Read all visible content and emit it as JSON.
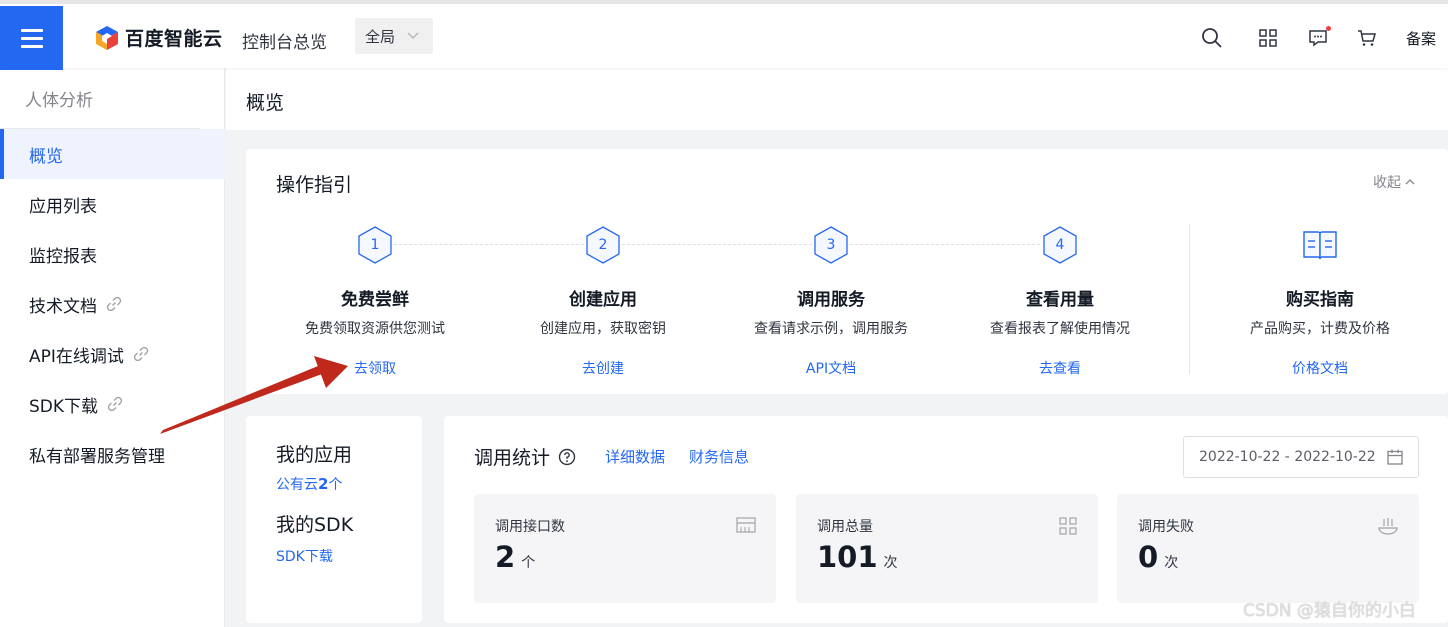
{
  "header": {
    "brand": "百度智能云",
    "console_title": "控制台总览",
    "region": "全局",
    "beian": "备案",
    "icons": [
      "menu-icon",
      "search-icon",
      "apps-grid-icon",
      "message-icon",
      "cart-icon"
    ]
  },
  "sidebar": {
    "title": "人体分析",
    "items": [
      {
        "label": "概览",
        "active": true,
        "external": false
      },
      {
        "label": "应用列表",
        "active": false,
        "external": false
      },
      {
        "label": "监控报表",
        "active": false,
        "external": false
      },
      {
        "label": "技术文档",
        "active": false,
        "external": true
      },
      {
        "label": "API在线调试",
        "active": false,
        "external": true
      },
      {
        "label": "SDK下载",
        "active": false,
        "external": true
      },
      {
        "label": "私有部署服务管理",
        "active": false,
        "external": false
      }
    ]
  },
  "page": {
    "title": "概览"
  },
  "guide": {
    "title": "操作指引",
    "collapse_label": "收起",
    "steps": [
      {
        "number": "1",
        "name": "免费尝鲜",
        "desc": "免费领取资源供您测试",
        "link": "去领取"
      },
      {
        "number": "2",
        "name": "创建应用",
        "desc": "创建应用，获取密钥",
        "link": "去创建"
      },
      {
        "number": "3",
        "name": "调用服务",
        "desc": "查看请求示例，调用服务",
        "link": "API文档"
      },
      {
        "number": "4",
        "name": "查看用量",
        "desc": "查看报表了解使用情况",
        "link": "去查看"
      }
    ],
    "purchase": {
      "name": "购买指南",
      "desc": "产品购买，计费及价格",
      "link": "价格文档"
    }
  },
  "my_apps": {
    "title": "我的应用",
    "public_cloud_prefix": "公有云",
    "public_cloud_count": "2",
    "public_cloud_unit": "个",
    "sdk_title": "我的SDK",
    "sdk_link": "SDK下载"
  },
  "stats": {
    "title": "调用统计",
    "tabs": [
      "详细数据",
      "财务信息"
    ],
    "date_range": "2022-10-22 - 2022-10-22",
    "metrics": [
      {
        "label": "调用接口数",
        "value": "2",
        "unit": "个",
        "icon": "interface-icon"
      },
      {
        "label": "调用总量",
        "value": "101",
        "unit": "次",
        "icon": "grid-icon"
      },
      {
        "label": "调用失败",
        "value": "0",
        "unit": "次",
        "icon": "failure-icon"
      }
    ]
  },
  "watermark": "CSDN @猿自你的小白",
  "colors": {
    "accent": "#2468f2",
    "annotation_arrow": "#c0281c"
  }
}
